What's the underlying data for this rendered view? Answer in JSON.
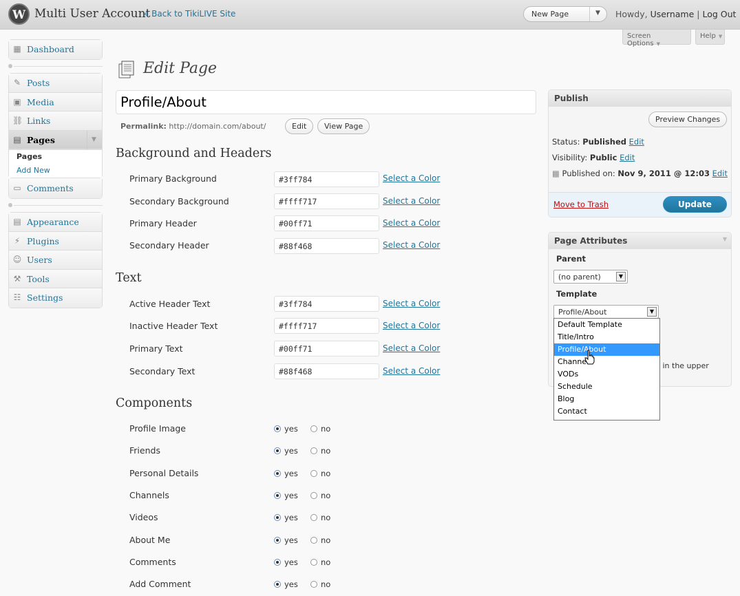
{
  "header": {
    "logo": "W",
    "site_title": "Multi User Account",
    "back_link": "« Back to TikiLIVE Site",
    "new_button": "New Page",
    "howdy_prefix": "Howdy, ",
    "username": "Username",
    "separator": " | ",
    "logout": "Log Out",
    "screen_options": "Screen Options",
    "help": "Help"
  },
  "sidebar": {
    "group1": [
      {
        "label": "Dashboard",
        "icon": "dashboard-icon"
      }
    ],
    "group2": [
      {
        "label": "Posts",
        "icon": "pin-icon"
      },
      {
        "label": "Media",
        "icon": "media-icon"
      },
      {
        "label": "Links",
        "icon": "links-icon"
      },
      {
        "label": "Pages",
        "icon": "pages-icon"
      }
    ],
    "pages_sub": [
      "Pages",
      "Add New"
    ],
    "comments": {
      "label": "Comments",
      "icon": "comments-icon"
    },
    "group3": [
      {
        "label": "Appearance",
        "icon": "appearance-icon"
      },
      {
        "label": "Plugins",
        "icon": "plugins-icon"
      },
      {
        "label": "Users",
        "icon": "users-icon"
      },
      {
        "label": "Tools",
        "icon": "tools-icon"
      },
      {
        "label": "Settings",
        "icon": "settings-icon"
      }
    ]
  },
  "page": {
    "heading": "Edit Page",
    "title_value": "Profile/About",
    "permalink_label": "Permalink:",
    "permalink_url": "http://domain.com/about/",
    "edit_btn": "Edit",
    "view_btn": "View Page"
  },
  "bg_section": {
    "title": "Background and Headers",
    "rows": [
      {
        "label": "Primary Background",
        "value": "#3ff784",
        "link": "Select a Color"
      },
      {
        "label": "Secondary Background",
        "value": "#ffff717",
        "link": "Select a Color"
      },
      {
        "label": "Primary Header",
        "value": "#00ff71",
        "link": "Select a Color"
      },
      {
        "label": "Secondary Header",
        "value": "#88f468",
        "link": "Select a Color"
      }
    ]
  },
  "text_section": {
    "title": "Text",
    "rows": [
      {
        "label": "Active Header Text",
        "value": "#3ff784",
        "link": "Select a Color"
      },
      {
        "label": "Inactive Header Text",
        "value": "#ffff717",
        "link": "Select a Color"
      },
      {
        "label": "Primary Text",
        "value": "#00ff71",
        "link": "Select a Color"
      },
      {
        "label": "Secondary Text",
        "value": "#88f468",
        "link": "Select a Color"
      }
    ]
  },
  "components": {
    "title": "Components",
    "yes": "yes",
    "no": "no",
    "rows": [
      {
        "label": "Profile Image",
        "selected": "yes"
      },
      {
        "label": "Friends",
        "selected": "yes"
      },
      {
        "label": "Personal Details",
        "selected": "yes"
      },
      {
        "label": "Channels",
        "selected": "yes"
      },
      {
        "label": "Videos",
        "selected": "yes"
      },
      {
        "label": "About Me",
        "selected": "yes"
      },
      {
        "label": "Comments",
        "selected": "yes"
      },
      {
        "label": "Add Comment",
        "selected": "yes"
      }
    ]
  },
  "publish": {
    "title": "Publish",
    "preview": "Preview Changes",
    "status_label": "Status: ",
    "status_value": "Published",
    "visibility_label": "Visibility: ",
    "visibility_value": "Public",
    "published_label": "Published on: ",
    "published_value": "Nov 9, 2011 @ 12:03",
    "edit": "Edit",
    "trash": "Move to Trash",
    "update": "Update"
  },
  "attributes": {
    "title": "Page Attributes",
    "parent_label": "Parent",
    "parent_value": "(no parent)",
    "template_label": "Template",
    "template_value": "Profile/About",
    "hint_fragment": "p in the upper",
    "template_options": [
      "Default Template",
      "Title/Intro",
      "Profile/About",
      "Channels",
      "VODs",
      "Schedule",
      "Blog",
      "Contact"
    ],
    "selected_index": 2
  },
  "colors": {
    "link": "#21759b",
    "update_button": "#21759b",
    "selected_option": "#3399ff"
  }
}
